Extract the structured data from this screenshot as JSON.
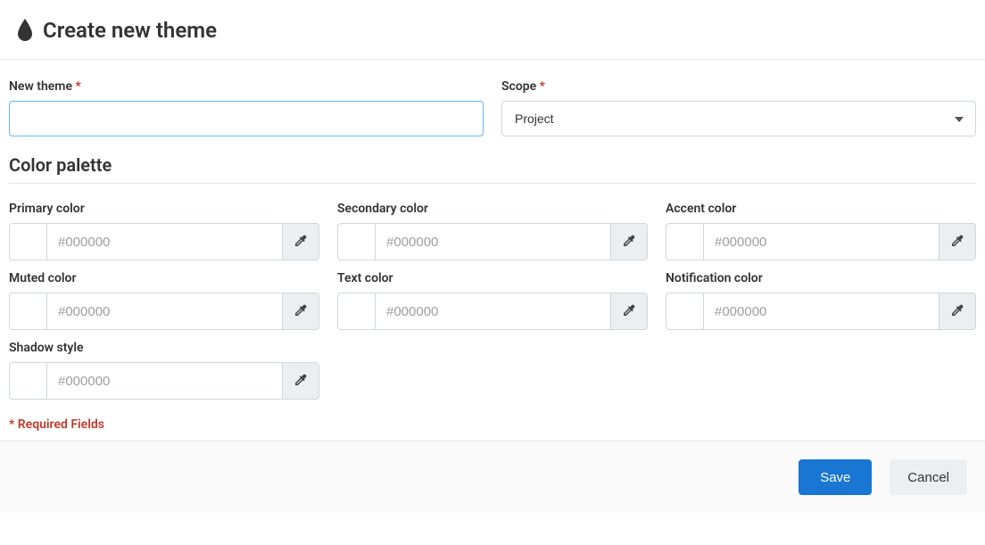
{
  "header": {
    "title": "Create new theme"
  },
  "form": {
    "name_label": "New theme",
    "name_value": "",
    "scope_label": "Scope",
    "scope_value": "Project"
  },
  "palette": {
    "section_title": "Color palette",
    "placeholder": "#000000",
    "fields": [
      {
        "label": "Primary color",
        "value": ""
      },
      {
        "label": "Secondary color",
        "value": ""
      },
      {
        "label": "Accent color",
        "value": ""
      },
      {
        "label": "Muted color",
        "value": ""
      },
      {
        "label": "Text color",
        "value": ""
      },
      {
        "label": "Notification color",
        "value": ""
      },
      {
        "label": "Shadow style",
        "value": ""
      }
    ]
  },
  "required_note": "* Required Fields",
  "footer": {
    "save_label": "Save",
    "cancel_label": "Cancel"
  }
}
